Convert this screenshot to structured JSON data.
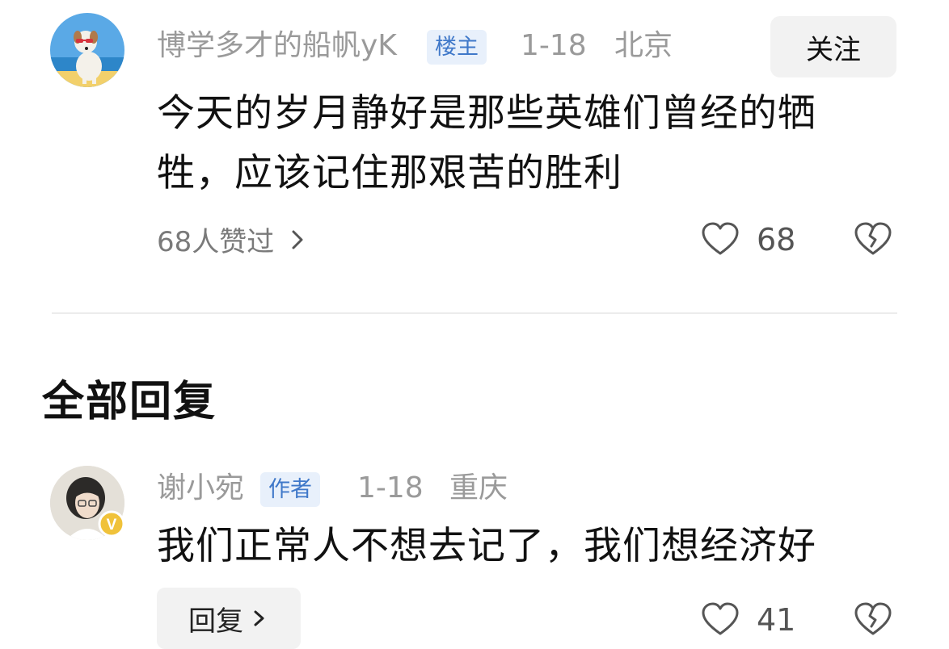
{
  "top_comment": {
    "username": "博学多才的船帆yK",
    "badge": "楼主",
    "date": "1-18",
    "location": "北京",
    "follow_label": "关注",
    "text_line1": "今天的岁月静好是那些英雄们曾经的牺",
    "text_line2": "牲，应该记住那艰苦的胜利",
    "likers_label": "68人赞过",
    "like_count": "68",
    "icons": [
      "heart-icon",
      "broken-heart-icon",
      "chevron-right-icon"
    ]
  },
  "section": {
    "title": "全部回复"
  },
  "reply": {
    "username": "谢小宛",
    "badge": "作者",
    "date": "1-18",
    "location": "重庆",
    "text": "我们正常人不想去记了，我们想经济好",
    "reply_label": "回复",
    "like_count": "41",
    "verified_mark": "V",
    "icons": [
      "heart-icon",
      "broken-heart-icon",
      "chevron-right-icon",
      "verified-badge-icon"
    ]
  },
  "colors": {
    "badge_text": "#3f78c9",
    "badge_bg": "#e8f0fb",
    "meta_gray": "#9a9a9a",
    "verified": "#f0c23a"
  }
}
